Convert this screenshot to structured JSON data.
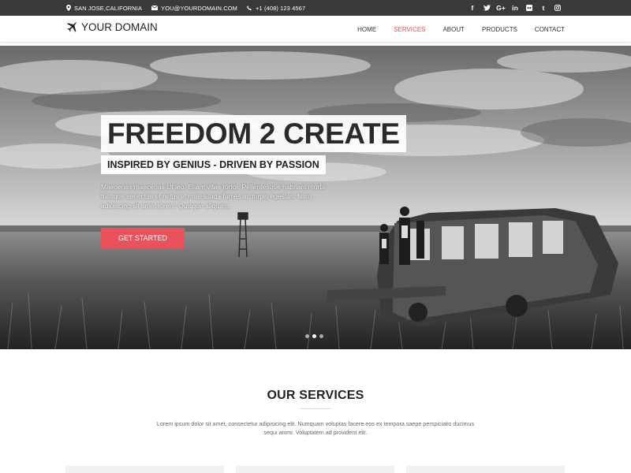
{
  "topbar": {
    "location": "SAN JOSE,CALIFORNIA",
    "email": "YOU@YOURDOMAIN.COM",
    "phone": "+1 (408) 123 4567",
    "social": [
      "f",
      "t",
      "G+",
      "in",
      "fl",
      "t",
      "ig"
    ]
  },
  "nav": {
    "brand": "YOUR DOMAIN",
    "items": [
      "HOME",
      "SERVICES",
      "ABOUT",
      "PRODUCTS",
      "CONTACT"
    ],
    "active": "SERVICES",
    "accent": "#e8505b"
  },
  "hero": {
    "title": "FREEDOM 2 CREATE",
    "subtitle": "INSPIRED BY GENIUS - DRIVEN BY PASSION",
    "text": "Maecenas maecenas Ut leo. Etiam vitae tortor. Pellentesque habitant morbi tristique senectus et netus et malesuada fames ac turpis egestas. Nam adipiscing sit amet lorem. Quisque aliquam.",
    "cta": "GET STARTED",
    "slides": 3,
    "active_slide": 2
  },
  "services": {
    "title": "OUR SERVICES",
    "text": "Lorem ipsum dolor sit amet, consectetur adipisicing elit. Numquam voluptas facere eos ex tempora saepe perspiciatis ducimus sequi animi. Voluptatem ad provident elit."
  }
}
